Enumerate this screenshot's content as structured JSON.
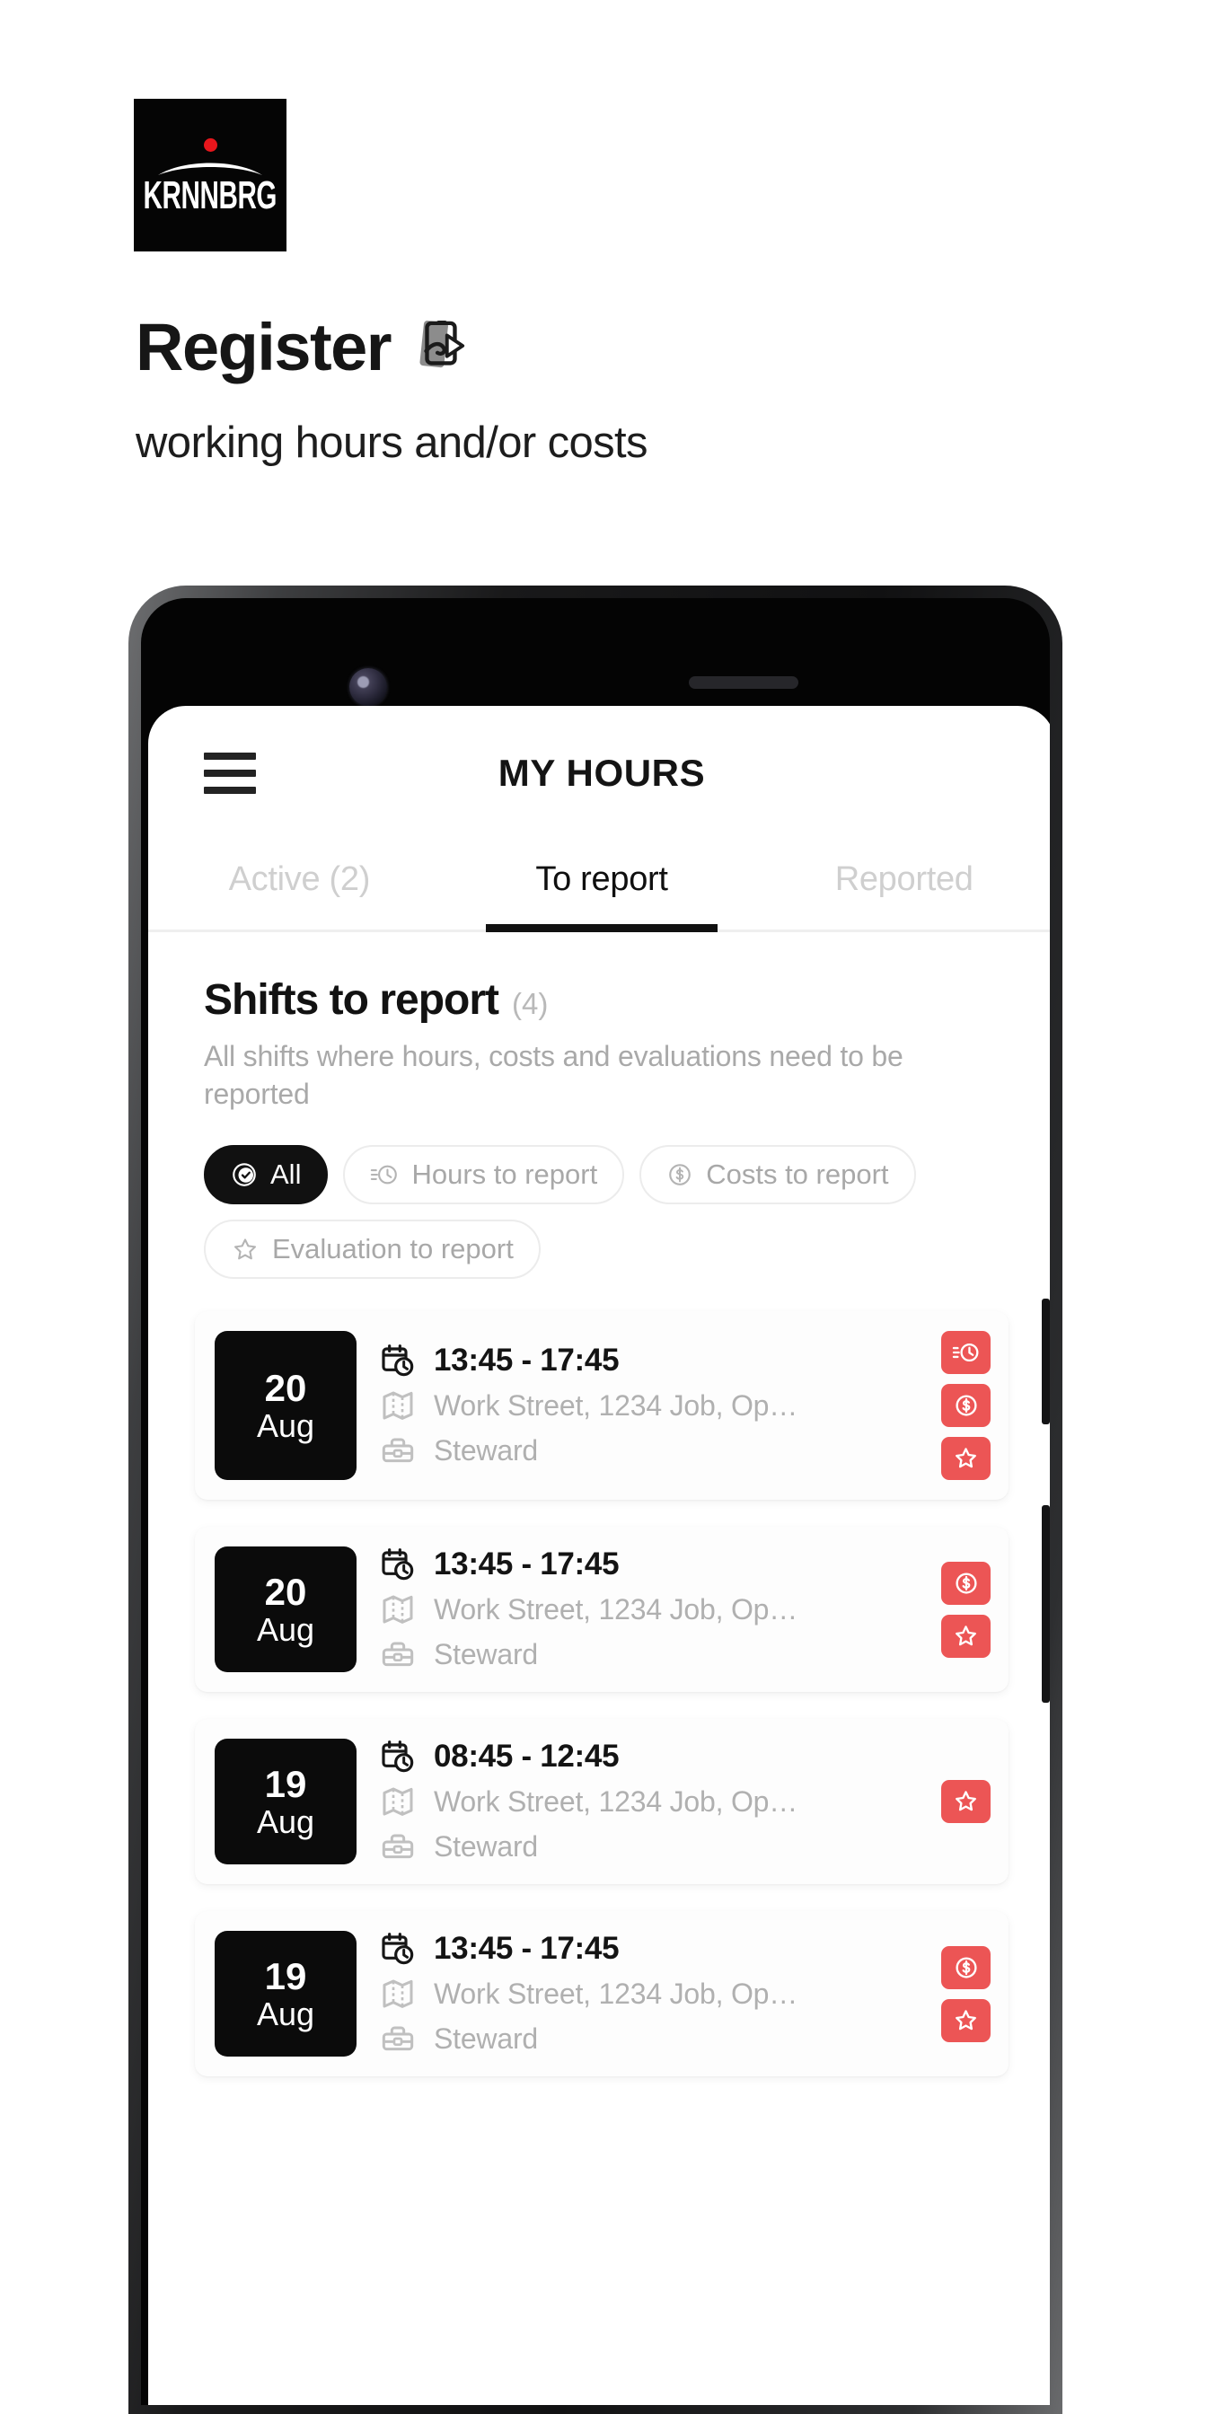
{
  "brand": {
    "logo_word": "KRNNBRG",
    "logo_dot_color": "#e8161c"
  },
  "hero": {
    "title": "Register",
    "emoji_name": "mobile-phone-with-arrow",
    "subtitle": "working hours and/or costs"
  },
  "app": {
    "menu_icon": "hamburger-icon",
    "title": "MY HOURS",
    "tabs": [
      {
        "label": "Active (2)",
        "active": false
      },
      {
        "label": "To report",
        "active": true
      },
      {
        "label": "Reported",
        "active": false
      }
    ],
    "section": {
      "title": "Shifts to report",
      "count": "(4)",
      "description": "All shifts where hours, costs and evaluations need to be reported"
    },
    "filters": [
      {
        "label": "All",
        "icon": "check-circle-icon",
        "active": true
      },
      {
        "label": "Hours to report",
        "icon": "clock-list-icon",
        "active": false
      },
      {
        "label": "Costs to report",
        "icon": "dollar-circle-icon",
        "active": false
      },
      {
        "label": "Evaluation to report",
        "icon": "star-icon",
        "active": false
      }
    ],
    "shifts": [
      {
        "day": "20",
        "month": "Aug",
        "time": "13:45 - 17:45",
        "location": "Work Street, 1234 Job, Op…",
        "role": "Steward",
        "badges": [
          "clock-list-icon",
          "dollar-circle-icon",
          "star-icon"
        ]
      },
      {
        "day": "20",
        "month": "Aug",
        "time": "13:45 - 17:45",
        "location": "Work Street, 1234 Job, Op…",
        "role": "Steward",
        "badges": [
          "dollar-circle-icon",
          "star-icon"
        ]
      },
      {
        "day": "19",
        "month": "Aug",
        "time": "08:45 - 12:45",
        "location": "Work Street, 1234 Job, Op…",
        "role": "Steward",
        "badges": [
          "star-icon"
        ]
      },
      {
        "day": "19",
        "month": "Aug",
        "time": "13:45 - 17:45",
        "location": "Work Street, 1234 Job, Op…",
        "role": "Steward",
        "badges": [
          "dollar-circle-icon",
          "star-icon"
        ]
      }
    ],
    "card_icons": {
      "time": "calendar-clock-icon",
      "location": "map-icon",
      "role": "toolbox-icon"
    },
    "accent_color": "#ec5555",
    "dark_color": "#0b0b0b"
  }
}
